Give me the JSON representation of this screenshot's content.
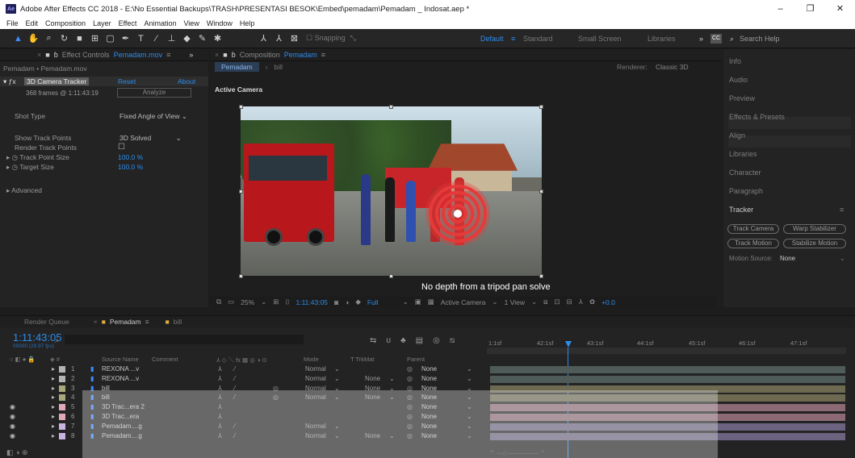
{
  "window": {
    "title": "Adobe After Effects CC 2018 - E:\\No Essential Backups\\TRASH\\PRESENTASI BESOK\\Embed\\pemadam\\Pemadam _ Indosat.aep *",
    "app_icon": "Ae",
    "controls": [
      "–",
      "❐",
      "✕"
    ]
  },
  "menu": [
    "File",
    "Edit",
    "Composition",
    "Layer",
    "Effect",
    "Animation",
    "View",
    "Window",
    "Help"
  ],
  "toolbar": {
    "snapping": "Snapping",
    "workspaces": [
      "Default",
      "Standard",
      "Small Screen",
      "Libraries"
    ],
    "search": "Search Help"
  },
  "effect_controls": {
    "tab": "Effect Controls",
    "tab_target": "Pemadam.mov",
    "layer_path": "Pemadam • Pemadam.mov",
    "effect": "3D Camera Tracker",
    "reset": "Reset",
    "about": "About",
    "frames": "368 frames @ 1:11:43:19",
    "analyze": "Analyze",
    "shot_type_label": "Shot Type",
    "shot_type_value": "Fixed Angle of View",
    "show_track_label": "Show Track Points",
    "show_track_value": "3D Solved",
    "render_track_label": "Render Track Points",
    "track_size_label": "Track Point Size",
    "track_size_value": "100.0 %",
    "target_size_label": "Target Size",
    "target_size_value": "100.0 %",
    "advanced": "Advanced"
  },
  "composition": {
    "tab": "Composition",
    "tab_target": "Pemadam",
    "sub_tabs": [
      "Pemadam",
      "bill"
    ],
    "renderer": "Renderer:",
    "renderer_value": "Classic 3D",
    "active_camera": "Active Camera",
    "message": "No depth from a tripod pan solve",
    "zoom": "25%",
    "timecode": "1:11:43:05",
    "resolution": "Full",
    "camera_view": "Active Camera",
    "views": "1 View",
    "offset": "+0.0"
  },
  "right_panel": {
    "items": [
      "Info",
      "Audio",
      "Preview",
      "Effects & Presets",
      "Align",
      "Libraries",
      "Character",
      "Paragraph",
      "Tracker"
    ],
    "buttons": [
      "Track Camera",
      "Warp Stabilizer",
      "Track Motion",
      "Stabilize Motion"
    ],
    "motion_source_label": "Motion Source:",
    "motion_source_value": "None"
  },
  "timeline": {
    "render_queue": "Render Queue",
    "comp_tab": "Pemadam",
    "bill_tab": "bill",
    "timecode": "1:11:43:05",
    "sub": "00000 (29.97 fps)",
    "columns": {
      "source": "Source Name",
      "comment": "Comment",
      "mode": "Mode",
      "trkmat": "T  TrkMat",
      "parent": "Parent"
    },
    "ruler": [
      "1:1sf",
      "42:1sf",
      "43:1sf",
      "44:1sf",
      "45:1sf",
      "46:1sf",
      "47:1sf"
    ],
    "layers": [
      {
        "num": "1",
        "name": "REXONA ...v",
        "mode": "Normal",
        "trk": "",
        "parent": "None",
        "color": "#b4b4b4",
        "bar": "#4f5b58"
      },
      {
        "num": "2",
        "name": "REXONA ...v",
        "mode": "Normal",
        "trk": "None",
        "parent": "None",
        "color": "#b4b4b4",
        "bar": "#4f5b58"
      },
      {
        "num": "3",
        "name": "bill",
        "mode": "Normal",
        "trk": "None",
        "parent": "None",
        "color": "#a8a87a",
        "bar": "#6e6a52"
      },
      {
        "num": "4",
        "name": "bill",
        "mode": "Normal",
        "trk": "None",
        "parent": "None",
        "color": "#a8a87a",
        "bar": "#6e6a52"
      },
      {
        "num": "5",
        "name": "3D Trac...era 2",
        "mode": "",
        "trk": "",
        "parent": "None",
        "color": "#e0a8b8",
        "bar": "#8b6a75"
      },
      {
        "num": "6",
        "name": "3D Trac...era",
        "mode": "",
        "trk": "",
        "parent": "None",
        "color": "#e0a8b8",
        "bar": "#8b6a75"
      },
      {
        "num": "7",
        "name": "Pemadam....g",
        "mode": "Normal",
        "trk": "",
        "parent": "None",
        "color": "#c8b4e0",
        "bar": "#6c6380"
      },
      {
        "num": "8",
        "name": "Pemadam....g",
        "mode": "Normal",
        "trk": "None",
        "parent": "None",
        "color": "#c8b4e0",
        "bar": "#6c6380"
      }
    ]
  }
}
